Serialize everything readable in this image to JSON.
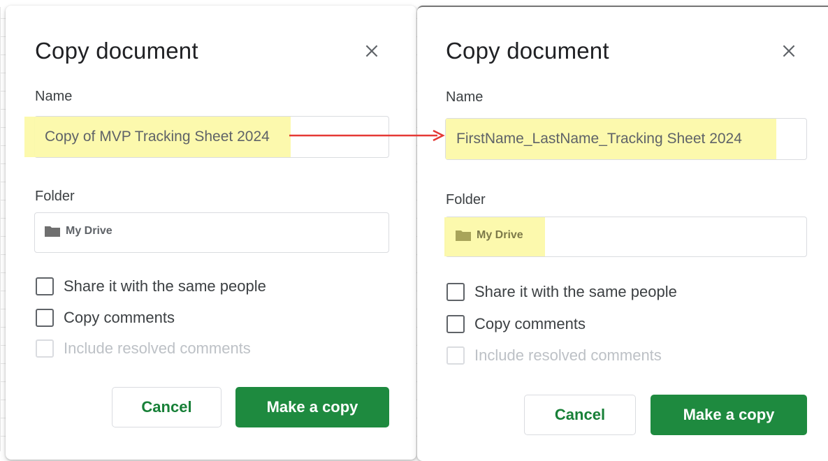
{
  "dialogs": [
    {
      "title": "Copy document",
      "name_label": "Name",
      "name_value": "Copy of MVP Tracking Sheet 2024",
      "folder_label": "Folder",
      "folder_value": "My Drive",
      "checkboxes": [
        {
          "label": "Share it with the same people",
          "checked": false,
          "disabled": false
        },
        {
          "label": "Copy comments",
          "checked": false,
          "disabled": false
        },
        {
          "label": "Include resolved comments",
          "checked": false,
          "disabled": true
        }
      ],
      "cancel_label": "Cancel",
      "copy_label": "Make a copy"
    },
    {
      "title": "Copy document",
      "name_label": "Name",
      "name_value": "FirstName_LastName_Tracking Sheet 2024",
      "folder_label": "Folder",
      "folder_value": "My Drive",
      "checkboxes": [
        {
          "label": "Share it with the same people",
          "checked": false,
          "disabled": false
        },
        {
          "label": "Copy comments",
          "checked": false,
          "disabled": false
        },
        {
          "label": "Include resolved comments",
          "checked": false,
          "disabled": true
        }
      ],
      "cancel_label": "Cancel",
      "copy_label": "Make a copy"
    }
  ],
  "colors": {
    "highlight": "#fcf8a6",
    "arrow": "#e53935",
    "primary_button": "#1e8a3f",
    "cancel_text": "#188038"
  },
  "icons": {
    "close": "close-icon",
    "folder": "folder-icon"
  }
}
